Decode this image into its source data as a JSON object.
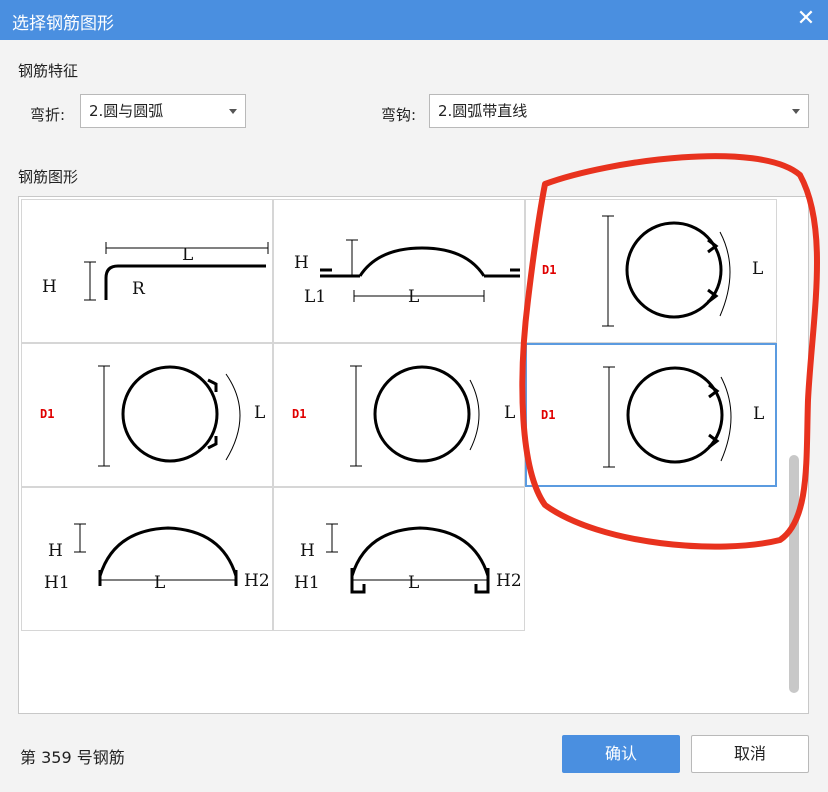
{
  "dialog": {
    "title": "选择钢筋图形",
    "close_glyph": "✕"
  },
  "features": {
    "section_label": "钢筋特征",
    "bend_label": "弯折:",
    "bend_value": "2.圆与圆弧",
    "hook_label": "弯钩:",
    "hook_value": "2.圆弧带直线"
  },
  "shapes": {
    "section_label": "钢筋图形",
    "cells": [
      {
        "name": "shape-bend-hook",
        "labels": [
          "H",
          "L",
          "R"
        ]
      },
      {
        "name": "shape-arc-hump",
        "labels": [
          "H",
          "L1",
          "L"
        ]
      },
      {
        "name": "shape-circle-hooks-top",
        "labels": [
          "D1",
          "L"
        ]
      },
      {
        "name": "shape-circle-hooks-left",
        "labels": [
          "D1",
          "L"
        ]
      },
      {
        "name": "shape-circle-plain",
        "labels": [
          "D1",
          "L"
        ]
      },
      {
        "name": "shape-circle-hooks-selected",
        "labels": [
          "D1",
          "L"
        ]
      },
      {
        "name": "shape-arch-straight",
        "labels": [
          "H",
          "H1",
          "L",
          "H2"
        ]
      },
      {
        "name": "shape-arch-hooked",
        "labels": [
          "H",
          "H1",
          "L",
          "H2"
        ]
      }
    ],
    "selected_index": 5
  },
  "footer": {
    "status_text": "第 359 号钢筋",
    "ok_label": "确认",
    "cancel_label": "取消"
  },
  "colors": {
    "accent": "#4a8fe0",
    "annotation_red": "#e8321e",
    "dim_label_red": "#e00000"
  }
}
